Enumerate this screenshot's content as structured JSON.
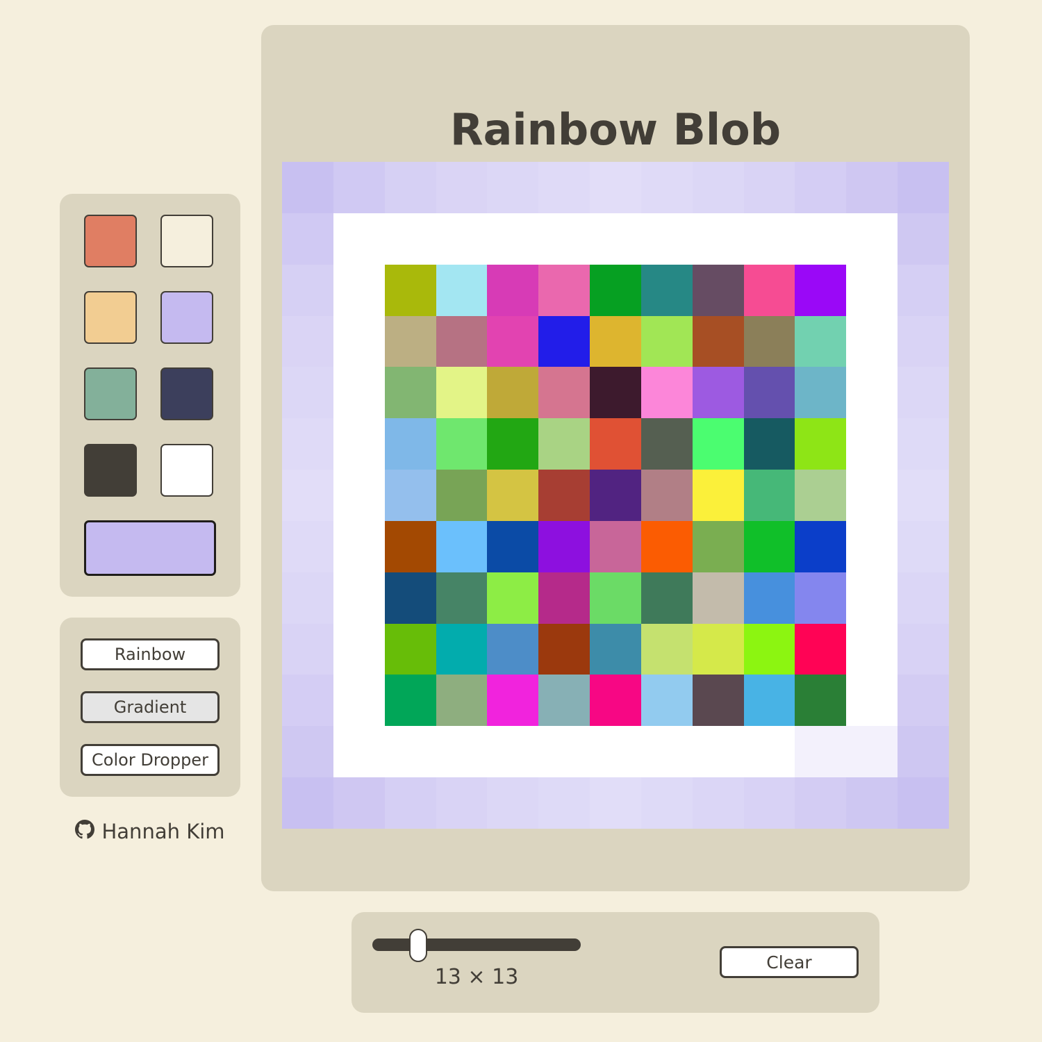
{
  "app": {
    "title": "Rainbow Blob",
    "author": "Hannah Kim",
    "author_icon": "github-icon"
  },
  "palette": {
    "swatches": [
      {
        "name": "swatch-coral",
        "color": "#e07e63"
      },
      {
        "name": "swatch-cream",
        "color": "#f5efdd"
      },
      {
        "name": "swatch-peach",
        "color": "#f2cd92"
      },
      {
        "name": "swatch-lavender",
        "color": "#c5baf0"
      },
      {
        "name": "swatch-sage",
        "color": "#83b09a"
      },
      {
        "name": "swatch-navy",
        "color": "#3c3f5c"
      },
      {
        "name": "swatch-charcoal",
        "color": "#423e37"
      },
      {
        "name": "swatch-white",
        "color": "#ffffff"
      }
    ],
    "current_color": "#c5baf0"
  },
  "tools": {
    "rainbow_label": "Rainbow",
    "gradient_label": "Gradient",
    "dropper_label": "Color Dropper",
    "active": "gradient"
  },
  "controls": {
    "size_label": "13 × 13",
    "clear_label": "Clear",
    "grid_size": 13,
    "slider_min": 2,
    "slider_max": 64
  },
  "grid": {
    "size": 13,
    "cells": [
      [
        "#c8c0f1",
        "#d0c9f3",
        "#d6d0f4",
        "#dad4f5",
        "#dcd7f6",
        "#dfdaf7",
        "#e2ddf8",
        "#dfdaf7",
        "#dcd7f6",
        "#d9d3f5",
        "#d4cdf4",
        "#cfc7f2",
        "#c8c0f1"
      ],
      [
        "#d0c9f3",
        "#ffffff",
        "#ffffff",
        "#ffffff",
        "#ffffff",
        "#ffffff",
        "#ffffff",
        "#ffffff",
        "#ffffff",
        "#ffffff",
        "#ffffff",
        "#ffffff",
        "#cfc8f2"
      ],
      [
        "#d6d0f4",
        "#ffffff",
        "#a9b90b",
        "#a3e6f2",
        "#d73bb6",
        "#ea68ae",
        "#06a022",
        "#268885",
        "#664c63",
        "#f64c93",
        "#9a08f7",
        "#ffffff",
        "#d5cff4"
      ],
      [
        "#dad4f5",
        "#ffffff",
        "#bcaf83",
        "#b67283",
        "#e243b1",
        "#221de9",
        "#ddb52f",
        "#a1e655",
        "#a74f24",
        "#8b7f59",
        "#72d1b0",
        "#ffffff",
        "#d9d3f5"
      ],
      [
        "#dcd7f6",
        "#ffffff",
        "#82b672",
        "#e3f487",
        "#bfa938",
        "#d57590",
        "#3d1a2d",
        "#fc86d9",
        "#9d5ae1",
        "#6450ae",
        "#6db5c8",
        "#ffffff",
        "#dcd7f6"
      ],
      [
        "#dfdaf7",
        "#ffffff",
        "#7fb8e8",
        "#6fe76e",
        "#22a713",
        "#a9d384",
        "#e05134",
        "#555f51",
        "#4bfd70",
        "#165a61",
        "#8ee516",
        "#ffffff",
        "#dedaf7"
      ],
      [
        "#e2ddf8",
        "#ffffff",
        "#94bfed",
        "#78a456",
        "#d4c443",
        "#a73e33",
        "#512381",
        "#b17f86",
        "#fbf03a",
        "#46b878",
        "#abcf92",
        "#ffffff",
        "#e1ddf8"
      ],
      [
        "#dfdaf7",
        "#ffffff",
        "#a34902",
        "#6bc0fc",
        "#0b4ba6",
        "#8d10df",
        "#c86699",
        "#fb5c02",
        "#7aae51",
        "#10bf29",
        "#0b3ec9",
        "#ffffff",
        "#dedaf7"
      ],
      [
        "#dcd7f6",
        "#ffffff",
        "#144c7a",
        "#468466",
        "#8ded45",
        "#b52a8a",
        "#6bdb66",
        "#3f7a5a",
        "#c3bbab",
        "#4790dd",
        "#8486ee",
        "#ffffff",
        "#dbd6f6"
      ],
      [
        "#d9d3f5",
        "#ffffff",
        "#67bd08",
        "#02acad",
        "#4d8dc8",
        "#9b390d",
        "#3d8ca9",
        "#c5e16f",
        "#d5e94a",
        "#8cf511",
        "#ff0355",
        "#ffffff",
        "#d8d2f5"
      ],
      [
        "#d4cdf4",
        "#ffffff",
        "#01a658",
        "#8eae7f",
        "#f123dd",
        "#87b0b5",
        "#f70784",
        "#92cbef",
        "#5a4850",
        "#48b3e5",
        "#2a7f36",
        "#ffffff",
        "#d3ccf3"
      ],
      [
        "#cfc8f2",
        "#ffffff",
        "#ffffff",
        "#ffffff",
        "#ffffff",
        "#ffffff",
        "#ffffff",
        "#ffffff",
        "#ffffff",
        "#ffffff",
        "#f3f1fc",
        "#f3f1fc",
        "#cec7f2"
      ],
      [
        "#c8c0f1",
        "#cfc7f2",
        "#d5cff4",
        "#d9d3f5",
        "#dcd7f6",
        "#dedaf7",
        "#e1ddf8",
        "#dedaf7",
        "#dbd6f6",
        "#d8d2f5",
        "#d3ccf3",
        "#cec7f2",
        "#c8c0f1"
      ]
    ]
  }
}
